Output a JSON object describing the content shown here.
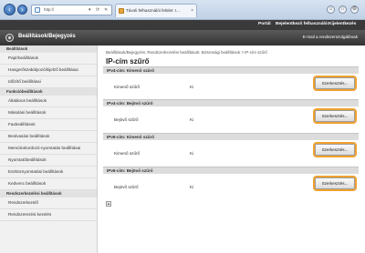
{
  "browser": {
    "url": "http://",
    "tab_title": "Távoli felhasználói felület: I...",
    "tab_close": "×",
    "back_icon": "back-arrow-icon",
    "forward_icon": "forward-arrow-icon"
  },
  "topbar": {
    "portal": "Portál",
    "login_user": "Bejelentkező felhasználó:",
    "logout": "Kijelentkezés"
  },
  "header": {
    "title": "Beállítások/Bejegyzés",
    "mail": "E-mail a rendszerszolgálónak"
  },
  "sidebar": {
    "sections": [
      {
        "heading": "Beállítások",
        "items": [
          "Papírbeállítások",
          "Hangerőszabályozó/kijelző beállításai",
          "Időzítő beállításai"
        ]
      },
      {
        "heading": "Funkcióbeállítások",
        "items": [
          "Általános beállítások",
          "Másolási beállítások",
          "Faxbeállítások",
          "Beolvasási beállítások",
          "Memóriahordozó-nyomtatás beállításai",
          "Nyomtatóbeállítások",
          "Eszköznyomtatási beállítások",
          "Kedvenc beállítások"
        ]
      },
      {
        "heading": "Rendszerkezelési beállítások",
        "items": [
          "Rendszerkezelő",
          "Rendszerezési kezelés"
        ]
      }
    ]
  },
  "main": {
    "breadcrumb": "Beállítások/Bejegyzés: Rendszerkezelési beállítások: Biztonsági beállítások > IP-cím szűrő",
    "title": "IP-cím szűrő",
    "sections": [
      {
        "heading": "IPv4-cím: Kimenő szűrő",
        "label": "Kimenő szűrő",
        "value": "Ki",
        "button": "Szerkesztés..."
      },
      {
        "heading": "IPv4-cím: Bejövő szűrő",
        "label": "Bejövő szűrő",
        "value": "Ki",
        "button": "Szerkesztés..."
      },
      {
        "heading": "IPv6-cím: Kimenő szűrő",
        "label": "Kimenő szűrő",
        "value": "Ki",
        "button": "Szerkesztés..."
      },
      {
        "heading": "IPv6-cím: Bejövő szűrő",
        "label": "Bejövő szűrő",
        "value": "Ki",
        "button": "Szerkesztés..."
      }
    ],
    "to_top": "▲"
  }
}
